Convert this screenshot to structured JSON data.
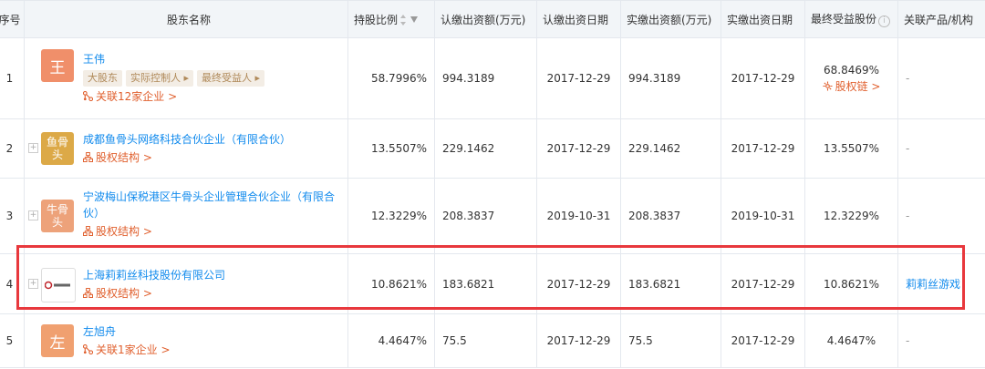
{
  "headers": {
    "index": "序号",
    "shareholder": "股东名称",
    "ratio": "持股比例",
    "subscribed_amount": "认缴出资额(万元)",
    "subscribed_date": "认缴出资日期",
    "paid_amount": "实缴出资额(万元)",
    "paid_date": "实缴出资日期",
    "final_benefit": "最终受益股份",
    "related": "关联产品/机构"
  },
  "colors": {
    "accent": "#128bed",
    "link_orange": "#e05f2d",
    "highlight_border": "#e8383d"
  },
  "rows": [
    {
      "index": "1",
      "logo_text": "王",
      "logo_color": "#f08f6a",
      "name": "王伟",
      "tags": [
        "大股东",
        "实际控制人 ▸",
        "最终受益人 ▸"
      ],
      "link": "关联12家企业 >",
      "link_icon": "network-icon",
      "ratio": "58.7996%",
      "subscribed_amount": "994.3189",
      "subscribed_date": "2017-12-29",
      "paid_amount": "994.3189",
      "paid_date": "2017-12-29",
      "final_benefit": "68.8469%",
      "benefit_link": "股权链 >",
      "related": "-"
    },
    {
      "index": "2",
      "logo_text": [
        "鱼骨",
        "头"
      ],
      "logo_color": "#dca947",
      "name": "成都鱼骨头网络科技合伙企业（有限合伙）",
      "link": "股权结构 >",
      "link_icon": "structure-icon",
      "ratio": "13.5507%",
      "subscribed_amount": "229.1462",
      "subscribed_date": "2017-12-29",
      "paid_amount": "229.1462",
      "paid_date": "2017-12-29",
      "final_benefit": "13.5507%",
      "related": "-"
    },
    {
      "index": "3",
      "logo_text": [
        "牛骨",
        "头"
      ],
      "logo_color": "#eda27a",
      "name": "宁波梅山保税港区牛骨头企业管理合伙企业（有限合伙）",
      "link": "股权结构 >",
      "link_icon": "structure-icon",
      "ratio": "12.3229%",
      "subscribed_amount": "208.3837",
      "subscribed_date": "2019-10-31",
      "paid_amount": "208.3837",
      "paid_date": "2019-10-31",
      "final_benefit": "12.3229%",
      "related": "-"
    },
    {
      "index": "4",
      "logo_text": "",
      "logo_color": "#ffffff",
      "name": "上海莉莉丝科技股份有限公司",
      "link": "股权结构 >",
      "link_icon": "structure-icon",
      "ratio": "10.8621%",
      "subscribed_amount": "183.6821",
      "subscribed_date": "2017-12-29",
      "paid_amount": "183.6821",
      "paid_date": "2017-12-29",
      "final_benefit": "10.8621%",
      "related": "莉莉丝游戏"
    },
    {
      "index": "5",
      "logo_text": "左",
      "logo_color": "#f0a070",
      "name": "左旭舟",
      "link": "关联1家企业 >",
      "link_icon": "network-icon",
      "ratio": "4.4647%",
      "subscribed_amount": "75.5",
      "subscribed_date": "2017-12-29",
      "paid_amount": "75.5",
      "paid_date": "2017-12-29",
      "final_benefit": "4.4647%",
      "related": "-"
    }
  ]
}
